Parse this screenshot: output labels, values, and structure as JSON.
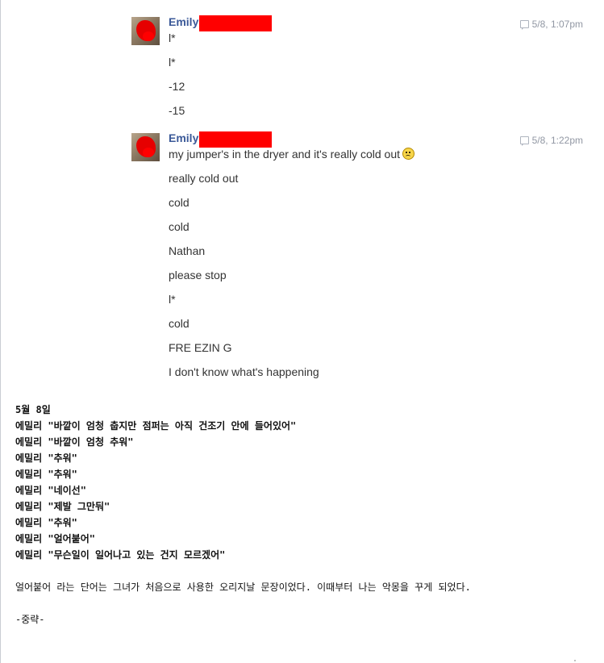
{
  "messages": [
    {
      "sender": "Emily",
      "time": "5/8, 1:07pm",
      "lines": [
        "l*",
        "l*",
        "-12",
        "-15"
      ]
    },
    {
      "sender": "Emily",
      "time": "5/8, 1:22pm",
      "lines": [
        "my jumper's in the dryer and it's really cold out",
        "really cold out",
        "cold",
        "cold",
        "Nathan",
        "please stop",
        "l*",
        "cold",
        "FRE EZIN G",
        "I don't know what's happening"
      ]
    }
  ],
  "translation": {
    "date": "5월 8일",
    "quotes": [
      "에밀리 \"바깥이 엄청 춥지만 점퍼는 아직 건조기 안에 들어있어\"",
      "에밀리 \"바깥이 엄청 추워\"",
      "에밀리 \"추워\"",
      "에밀리 \"추워\"",
      "에밀리 \"네이선\"",
      "에밀리 \"제발 그만둬\"",
      "에밀리 \"추워\"",
      "에밀리 \"얼어붙어\"",
      "에밀리 \"무슨일이 일어나고 있는 건지 모르겠어\""
    ],
    "paragraph": "얼어붙어 라는 단어는 그녀가 처음으로 사용한 오리지날 문장이었다. 이때부터 나는 악몽을 꾸게 되었다.",
    "omitted": "-중략-"
  },
  "colors": {
    "sender": "#3b5998",
    "redaction": "#ff0000",
    "timestamp": "#9197a3"
  },
  "icons": [
    "chat-bubble-icon",
    "frown-emoji-icon",
    "avatar"
  ]
}
